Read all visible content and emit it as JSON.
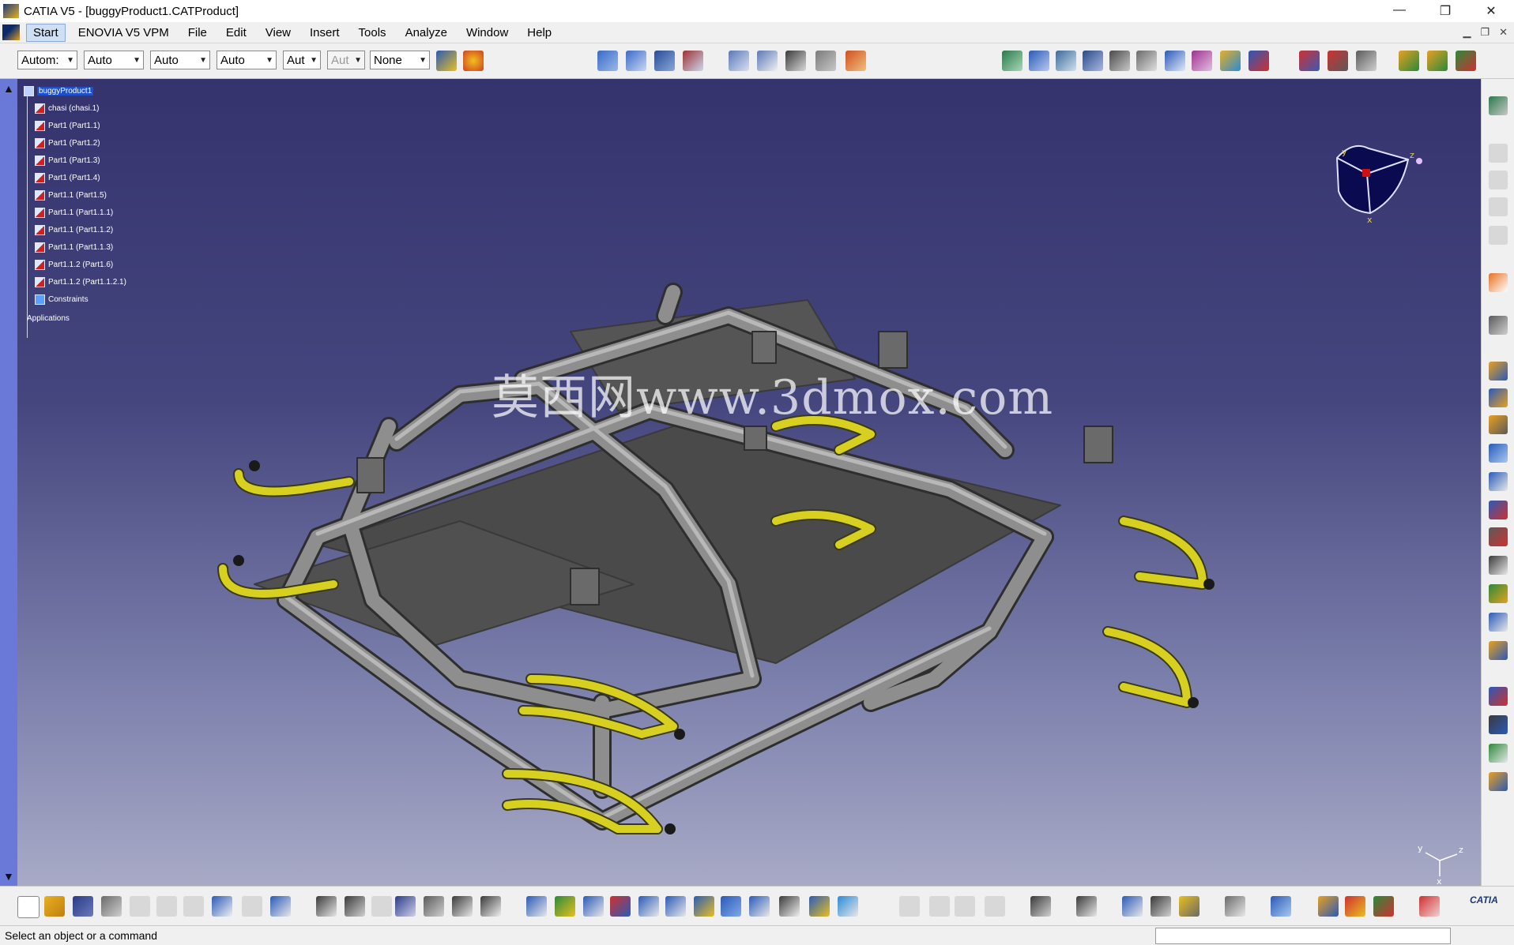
{
  "window": {
    "title": "CATIA V5 - [buggyProduct1.CATProduct]",
    "controls": [
      "—",
      "❐",
      "✕"
    ]
  },
  "menu": {
    "items": [
      "Start",
      "ENOVIA V5 VPM",
      "File",
      "Edit",
      "View",
      "Insert",
      "Tools",
      "Analyze",
      "Window",
      "Help"
    ]
  },
  "toolbar": {
    "combos": [
      {
        "value": "Autom:"
      },
      {
        "value": "Auto"
      },
      {
        "value": "Auto"
      },
      {
        "value": "Auto"
      },
      {
        "value": "Aut"
      },
      {
        "value": "Aut"
      },
      {
        "value": "None"
      }
    ]
  },
  "tree": {
    "root": "buggyProduct1",
    "children": [
      "chasi (chasi.1)",
      "Part1 (Part1.1)",
      "Part1 (Part1.2)",
      "Part1 (Part1.3)",
      "Part1 (Part1.4)",
      "Part1.1 (Part1.5)",
      "Part1.1 (Part1.1.1)",
      "Part1.1 (Part1.1.2)",
      "Part1.1 (Part1.1.3)",
      "Part1.1.2 (Part1.6)",
      "Part1.1.2 (Part1.1.2.1)"
    ],
    "constraints": "Constraints",
    "applications": "Applications"
  },
  "compass": {
    "y": "y",
    "x": "x",
    "z": "z"
  },
  "axes": {
    "y": "y",
    "z": "z",
    "x": "x"
  },
  "watermark": "莫西网www.3dmox.com",
  "status": {
    "message": "Select an object or a command"
  },
  "brand": "CATIA",
  "colors": {
    "viewport_top": "#35336e",
    "viewport_bottom": "#a8aac6",
    "tube": "#8a8a8a",
    "highlight_tube": "#c8c020"
  }
}
